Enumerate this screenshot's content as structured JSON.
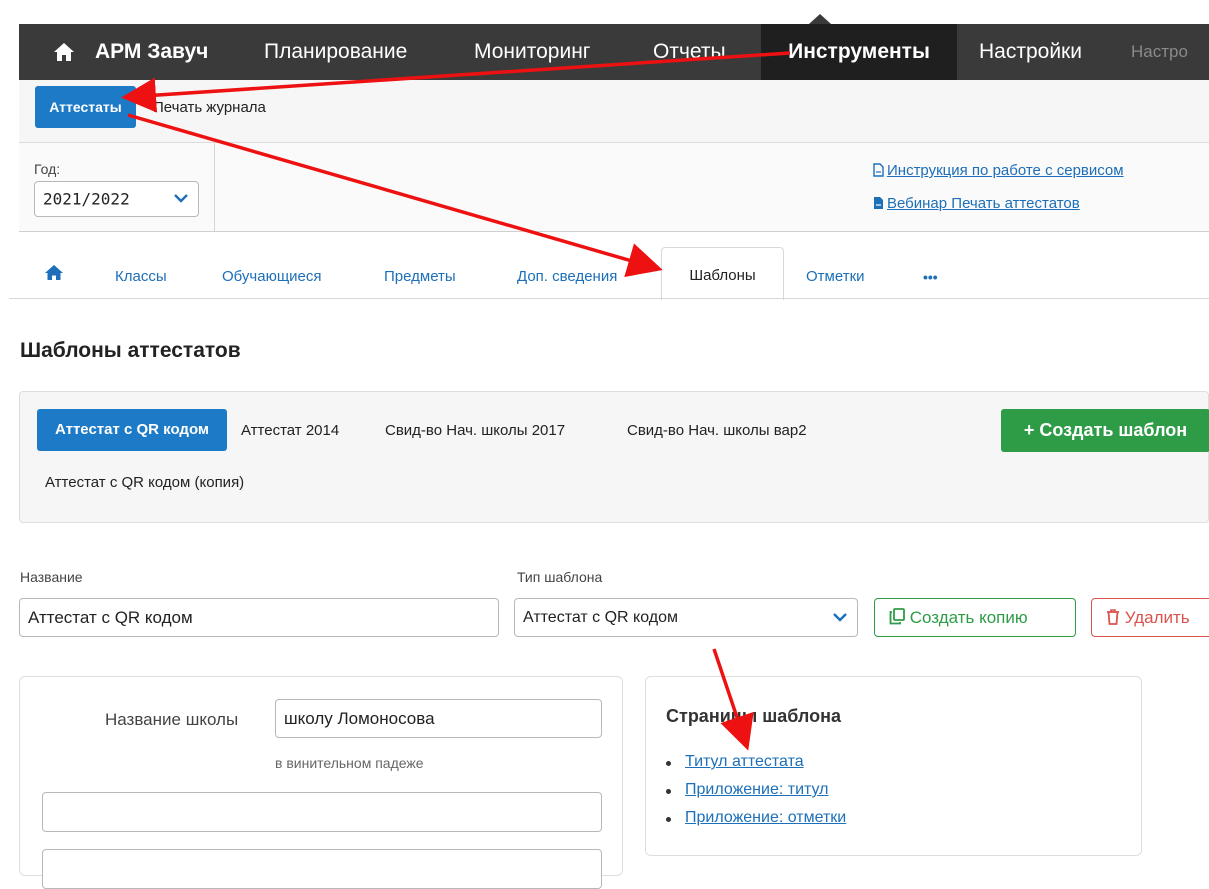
{
  "topnav": {
    "brand": "АРМ Завуч",
    "items": [
      "Планирование",
      "Мониторинг",
      "Отчеты",
      "Инструменты",
      "Настройки"
    ],
    "overflow": "Настро",
    "active_index": 3,
    "background": "#3a3a3a"
  },
  "subnav": {
    "buttons": [
      "Аттестаты",
      "Печать журнала"
    ],
    "active_index": 0
  },
  "filter": {
    "year_label": "Год:",
    "year_value": "2021/2022"
  },
  "help_links": [
    "Инструкция по работе с сервисом",
    "Вебинар Печать аттестатов"
  ],
  "tabs": {
    "items": [
      "Классы",
      "Обучающиеся",
      "Предметы",
      "Доп. сведения",
      "Шаблоны",
      "Отметки",
      "•••"
    ],
    "active_index": 4
  },
  "page_title": "Шаблоны аттестатов",
  "templates": {
    "items": [
      "Аттестат с QR кодом",
      "Аттестат 2014",
      "Свид-во Нач. школы 2017",
      "Свид-во Нач. школы вар2",
      "Аттестат с QR кодом (копия)"
    ],
    "active_index": 0,
    "create_button": "+ Создать шаблон"
  },
  "form": {
    "name_label": "Название",
    "name_value": "Аттестат с QR кодом",
    "type_label": "Тип шаблона",
    "type_value": "Аттестат с QR кодом",
    "copy_button": "Создать копию",
    "delete_button": "Удалить"
  },
  "school_panel": {
    "school_label": "Название школы",
    "school_value": "школу Ломоносова",
    "hint": "в винительном падеже"
  },
  "pages_panel": {
    "title": "Страницы шаблона",
    "links": [
      "Титул аттестата",
      "Приложение: титул",
      "Приложение: отметки"
    ]
  },
  "colors": {
    "primary": "#1c7ac7",
    "success": "#2e9c47",
    "danger": "#d9534f",
    "link": "#1c6fb8",
    "annotation_arrow": "#ee1111"
  },
  "icons": {
    "home": "home-icon",
    "dropdown": "chevron-down-icon",
    "pdf": "pdf-file-icon",
    "copy": "copy-icon",
    "trash": "trash-icon",
    "more": "ellipsis-icon"
  }
}
